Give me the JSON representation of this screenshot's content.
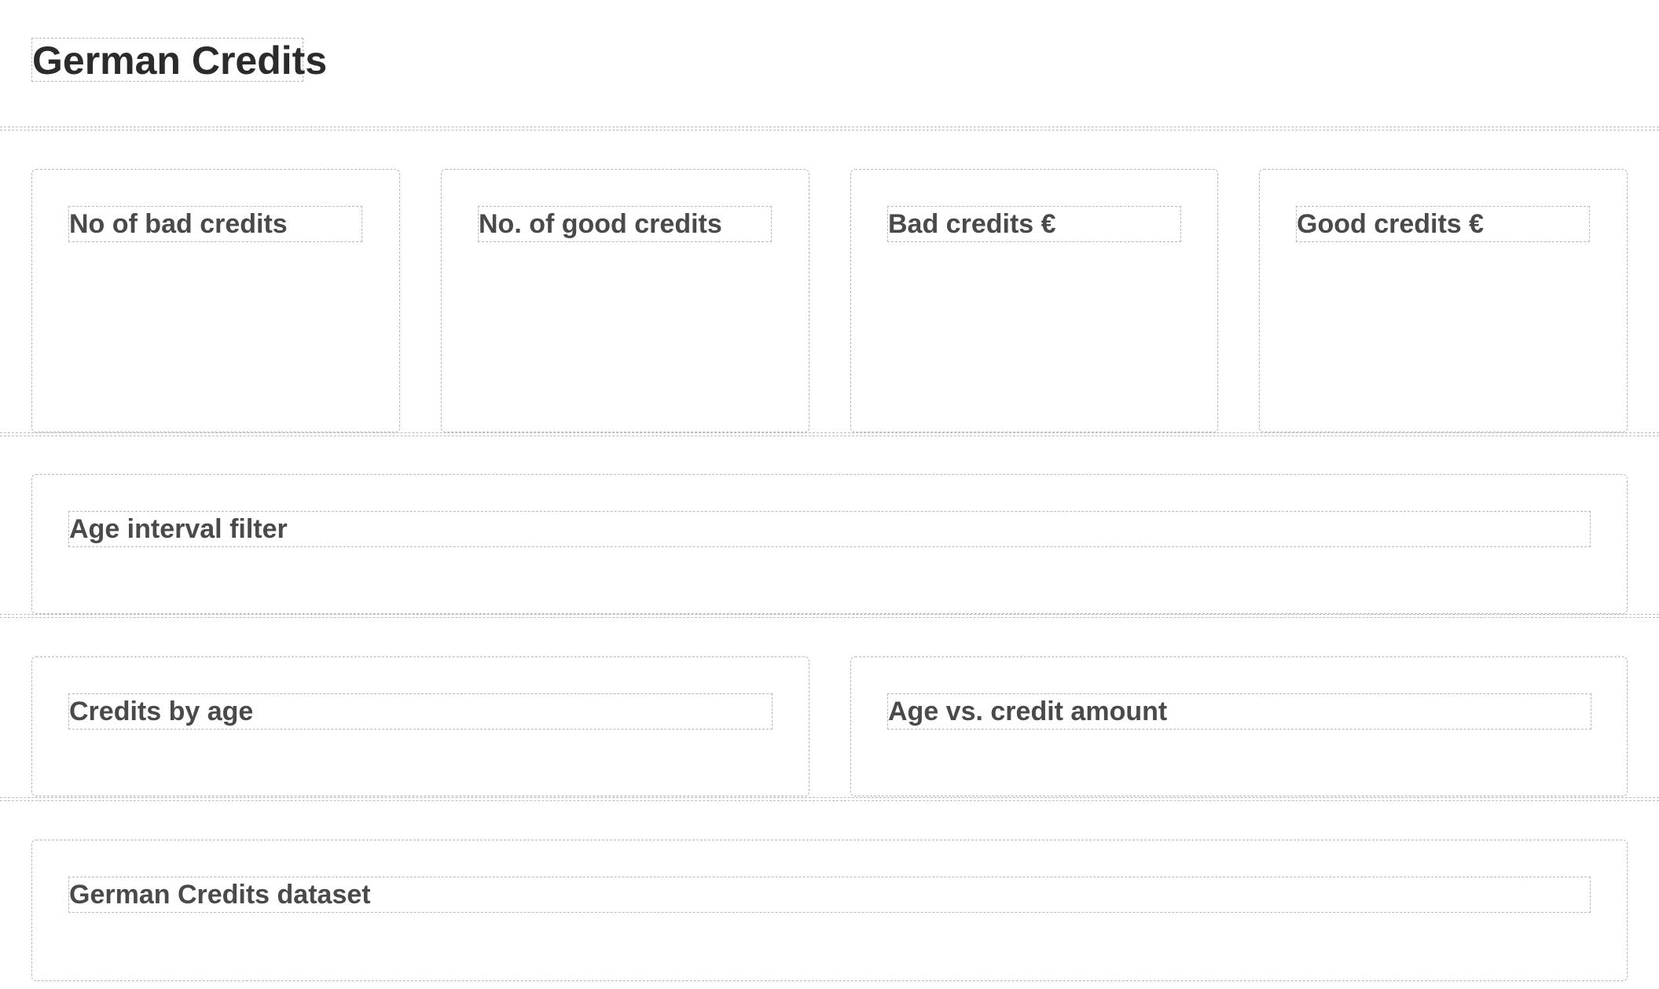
{
  "page": {
    "title": "German Credits"
  },
  "kpis": [
    {
      "title": "No of bad credits"
    },
    {
      "title": "No. of good credits"
    },
    {
      "title": "Bad credits €"
    },
    {
      "title": "Good credits €"
    }
  ],
  "filter": {
    "title": "Age interval filter"
  },
  "charts": [
    {
      "title": "Credits by age"
    },
    {
      "title": "Age vs. credit amount"
    }
  ],
  "table": {
    "title": "German Credits dataset"
  }
}
